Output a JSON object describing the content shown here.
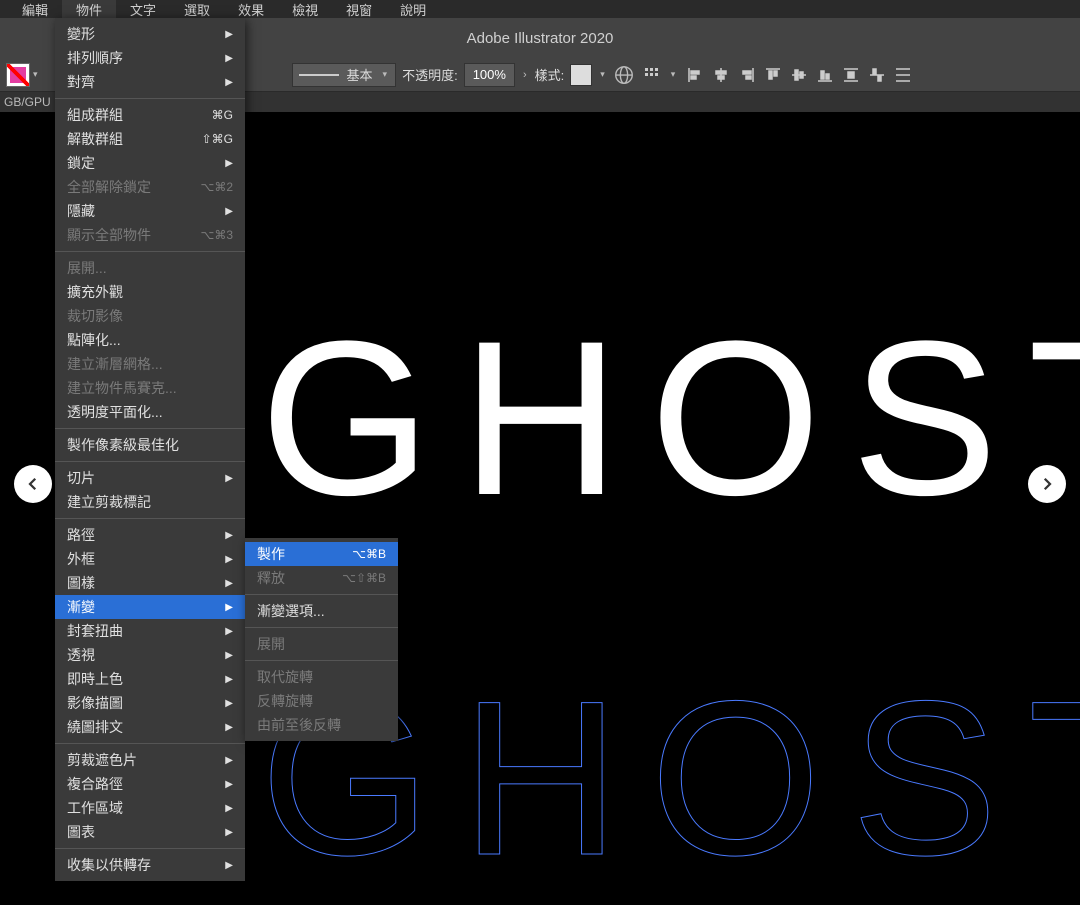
{
  "menubar": [
    "編輯",
    "物件",
    "文字",
    "選取",
    "效果",
    "檢視",
    "視窗",
    "說明"
  ],
  "activeMenu": 1,
  "appTitle": "Adobe Illustrator 2020",
  "docTab": "GB/GPU",
  "controlBar": {
    "strokeLabel": "基本",
    "opacityLabel": "不透明度:",
    "opacityValue": "100%",
    "styleLabel": "樣式:"
  },
  "canvas": {
    "text": "GHOST"
  },
  "dropdown": [
    {
      "label": "變形",
      "arrow": true
    },
    {
      "label": "排列順序",
      "arrow": true
    },
    {
      "label": "對齊",
      "arrow": true
    },
    {
      "sep": true
    },
    {
      "label": "組成群組",
      "shortcut": "⌘G"
    },
    {
      "label": "解散群組",
      "shortcut": "⇧⌘G"
    },
    {
      "label": "鎖定",
      "arrow": true
    },
    {
      "label": "全部解除鎖定",
      "shortcut": "⌥⌘2",
      "disabled": true
    },
    {
      "label": "隱藏",
      "arrow": true
    },
    {
      "label": "顯示全部物件",
      "shortcut": "⌥⌘3",
      "disabled": true
    },
    {
      "sep": true
    },
    {
      "label": "展開...",
      "disabled": true
    },
    {
      "label": "擴充外觀"
    },
    {
      "label": "裁切影像",
      "disabled": true
    },
    {
      "label": "點陣化..."
    },
    {
      "label": "建立漸層網格...",
      "disabled": true
    },
    {
      "label": "建立物件馬賽克...",
      "disabled": true
    },
    {
      "label": "透明度平面化..."
    },
    {
      "sep": true
    },
    {
      "label": "製作像素級最佳化"
    },
    {
      "sep": true
    },
    {
      "label": "切片",
      "arrow": true
    },
    {
      "label": "建立剪裁標記"
    },
    {
      "sep": true
    },
    {
      "label": "路徑",
      "arrow": true
    },
    {
      "label": "外框",
      "arrow": true
    },
    {
      "label": "圖樣",
      "arrow": true
    },
    {
      "label": "漸變",
      "arrow": true,
      "highlight": true
    },
    {
      "label": "封套扭曲",
      "arrow": true
    },
    {
      "label": "透視",
      "arrow": true
    },
    {
      "label": "即時上色",
      "arrow": true
    },
    {
      "label": "影像描圖",
      "arrow": true
    },
    {
      "label": "繞圖排文",
      "arrow": true
    },
    {
      "sep": true
    },
    {
      "label": "剪裁遮色片",
      "arrow": true
    },
    {
      "label": "複合路徑",
      "arrow": true
    },
    {
      "label": "工作區域",
      "arrow": true
    },
    {
      "label": "圖表",
      "arrow": true
    },
    {
      "sep": true
    },
    {
      "label": "收集以供轉存",
      "arrow": true
    }
  ],
  "submenu": [
    {
      "label": "製作",
      "shortcut": "⌥⌘B",
      "highlight": true
    },
    {
      "label": "釋放",
      "shortcut": "⌥⇧⌘B",
      "disabled": true
    },
    {
      "sep": true
    },
    {
      "label": "漸變選項..."
    },
    {
      "sep": true
    },
    {
      "label": "展開",
      "disabled": true
    },
    {
      "sep": true
    },
    {
      "label": "取代旋轉",
      "disabled": true
    },
    {
      "label": "反轉旋轉",
      "disabled": true
    },
    {
      "label": "由前至後反轉",
      "disabled": true
    }
  ]
}
